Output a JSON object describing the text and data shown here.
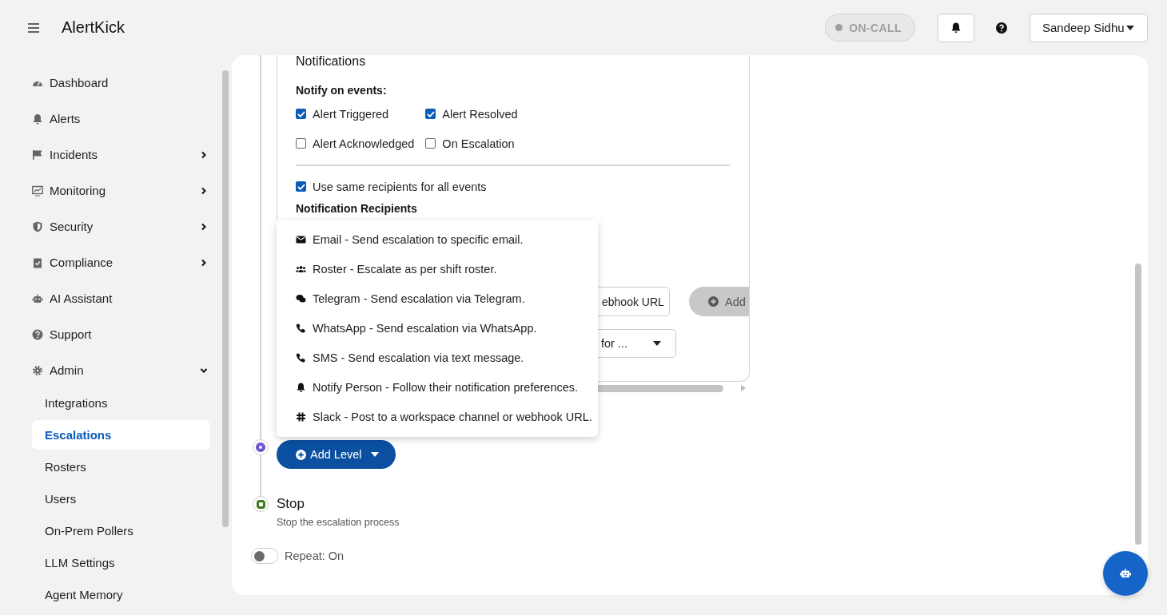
{
  "app": {
    "title": "AlertKick"
  },
  "header": {
    "status": {
      "label": "ON-CALL",
      "on": false
    },
    "user": "Sandeep Sidhu"
  },
  "sidebar": {
    "items": [
      {
        "label": "Dashboard"
      },
      {
        "label": "Alerts"
      },
      {
        "label": "Incidents",
        "expanded": false
      },
      {
        "label": "Monitoring",
        "expanded": false
      },
      {
        "label": "Security",
        "expanded": false
      },
      {
        "label": "Compliance",
        "expanded": false
      },
      {
        "label": "AI Assistant"
      },
      {
        "label": "Support"
      },
      {
        "label": "Admin",
        "expanded": true,
        "children": [
          {
            "label": "Integrations",
            "selected": false
          },
          {
            "label": "Escalations",
            "selected": true
          },
          {
            "label": "Rosters",
            "selected": false
          },
          {
            "label": "Users",
            "selected": false
          },
          {
            "label": "On-Prem Pollers",
            "selected": false
          },
          {
            "label": "LLM Settings",
            "selected": false
          },
          {
            "label": "Agent Memory",
            "selected": false
          }
        ]
      }
    ]
  },
  "notifications": {
    "heading": "Notifications",
    "events_label": "Notify on events:",
    "events": [
      {
        "label": "Alert Triggered",
        "checked": true
      },
      {
        "label": "Alert Resolved",
        "checked": true
      },
      {
        "label": "Alert Acknowledged",
        "checked": false
      },
      {
        "label": "On Escalation",
        "checked": false
      }
    ],
    "same_recipients": {
      "label": "Use same recipients for all events",
      "checked": true
    },
    "recipients_heading": "Notification Recipients",
    "webhook_button": "ebhook URL",
    "add_button": "Add",
    "select": "for ..."
  },
  "add_menu": {
    "items": [
      {
        "label": "Email - Send escalation to specific email."
      },
      {
        "label": "Roster - Escalate as per shift roster."
      },
      {
        "label": "Telegram - Send escalation via Telegram."
      },
      {
        "label": "WhatsApp - Send escalation via WhatsApp."
      },
      {
        "label": "SMS - Send escalation via text message."
      },
      {
        "label": "Notify Person - Follow their notification preferences."
      },
      {
        "label": "Slack - Post to a workspace channel or webhook URL."
      }
    ]
  },
  "add_level_button": "Add Level",
  "stop": {
    "title": "Stop",
    "description": "Stop the escalation process"
  },
  "repeat": {
    "label": "Repeat: On",
    "on": false
  }
}
